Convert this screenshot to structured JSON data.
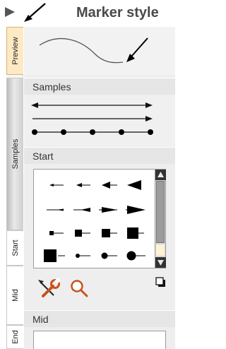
{
  "header": {
    "title": "Marker style",
    "collapse_icon": "triangle-right-icon",
    "pointer_icon": "arrow-icon"
  },
  "tabs": [
    {
      "label": "Preview",
      "active": true
    },
    {
      "label": "Samples",
      "active": false
    },
    {
      "label": "Start",
      "active": false
    },
    {
      "label": "Mid",
      "active": false
    },
    {
      "label": "End",
      "active": false
    }
  ],
  "sections": {
    "samples": "Samples",
    "start": "Start",
    "mid": "Mid"
  },
  "tools": {
    "wrench_icon": "wrench-icon",
    "zoom_icon": "magnifier-icon",
    "square_icon": "square-icon"
  },
  "colors": {
    "active_tab": "#fde9c4",
    "header_text": "#4a4a4a",
    "tool_accent": "#cf4a14"
  }
}
